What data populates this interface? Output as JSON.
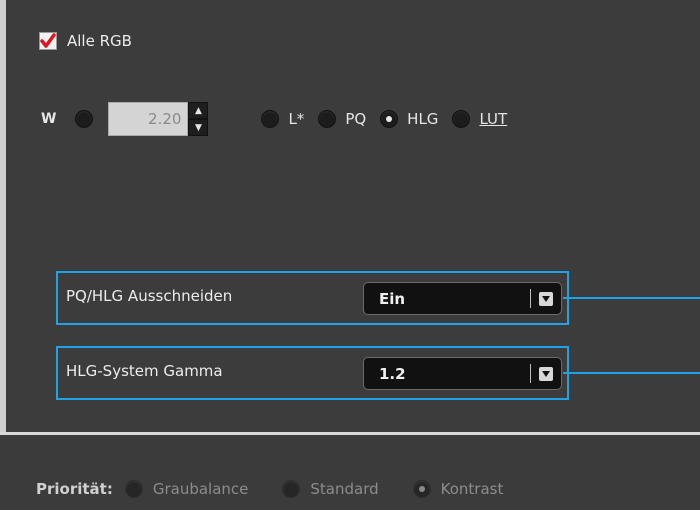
{
  "checkbox": {
    "label": "Alle RGB",
    "checked": true
  },
  "gamma": {
    "w_label": "W",
    "value": "2.20",
    "options": [
      {
        "label": "L*",
        "selected": false,
        "link": false
      },
      {
        "label": "PQ",
        "selected": false,
        "link": false
      },
      {
        "label": "HLG",
        "selected": true,
        "link": false
      },
      {
        "label": "LUT",
        "selected": false,
        "link": true
      }
    ]
  },
  "settings": {
    "clip": {
      "label": "PQ/HLG Ausschneiden",
      "value": "Ein"
    },
    "hlg_gamma": {
      "label": "HLG-System Gamma",
      "value": "1.2"
    }
  },
  "priority": {
    "label": "Priorität:",
    "options": [
      {
        "label": "Graubalance",
        "selected": false
      },
      {
        "label": "Standard",
        "selected": false
      },
      {
        "label": "Kontrast",
        "selected": true
      }
    ]
  },
  "colors": {
    "accent": "#1ea3e8",
    "check": "#e0141e"
  }
}
